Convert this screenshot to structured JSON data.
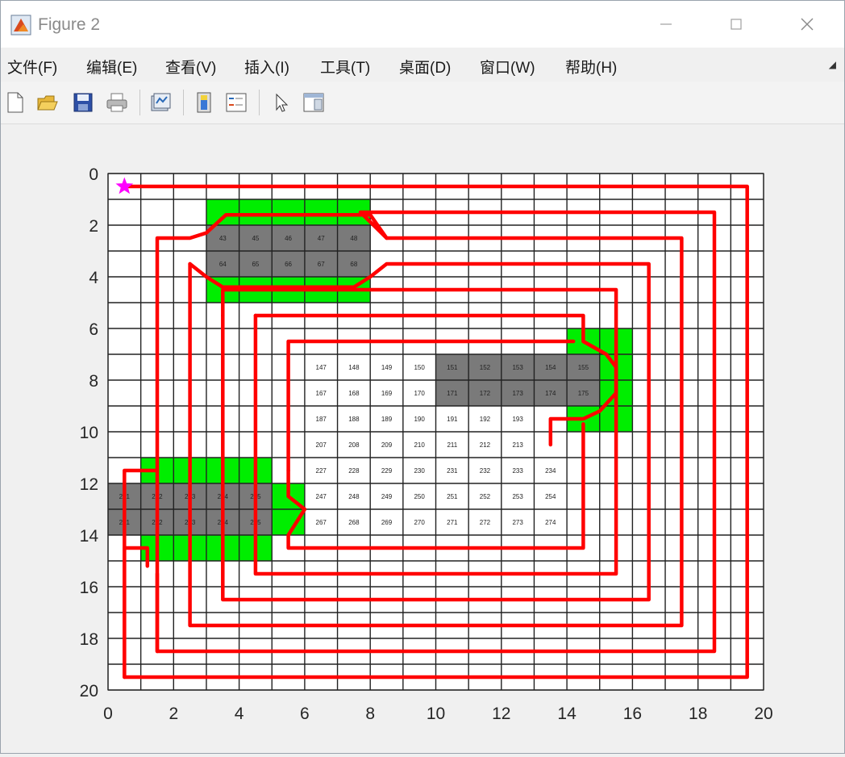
{
  "window": {
    "title": "Figure 2",
    "min_icon": "minimize-icon",
    "max_icon": "maximize-icon",
    "close_icon": "close-icon"
  },
  "menu": {
    "items": [
      "文件(F)",
      "编辑(E)",
      "查看(V)",
      "插入(I)",
      "工具(T)",
      "桌面(D)",
      "窗口(W)",
      "帮助(H)"
    ]
  },
  "toolbar": {
    "buttons": [
      "new-figure-icon",
      "open-file-icon",
      "save-icon",
      "print-icon",
      "link-plot-icon",
      "insert-colorbar-icon",
      "insert-legend-icon",
      "edit-plot-icon",
      "property-inspector-icon"
    ]
  },
  "plot": {
    "x_ticks": [
      "0",
      "2",
      "4",
      "6",
      "8",
      "10",
      "12",
      "14",
      "16",
      "18",
      "20"
    ],
    "y_ticks": [
      "0",
      "2",
      "4",
      "6",
      "8",
      "10",
      "12",
      "14",
      "16",
      "18",
      "20"
    ],
    "colors": {
      "path": "#ff0000",
      "obstacle": "#7a7a7a",
      "buffer": "#00ee00",
      "start": "#ff00ff",
      "grid": "#222222"
    }
  },
  "chart_data": {
    "type": "grid-path",
    "xlim": [
      0,
      20
    ],
    "ylim": [
      0,
      20
    ],
    "y_direction": "reversed",
    "grid": true,
    "start_marker": {
      "x": 0.5,
      "y": 0.5,
      "shape": "star"
    },
    "obstacles": [
      {
        "x_range": [
          3,
          8
        ],
        "y_range": [
          2,
          4
        ]
      },
      {
        "x_range": [
          10,
          15
        ],
        "y_range": [
          7,
          9
        ]
      },
      {
        "x_range": [
          0,
          5
        ],
        "y_range": [
          12,
          14
        ]
      }
    ],
    "buffer_zones": [
      {
        "x_range": [
          3,
          8
        ],
        "y_range": [
          1,
          5
        ]
      },
      {
        "x_range": [
          14,
          16
        ],
        "y_range": [
          6,
          10
        ]
      },
      {
        "x_range": [
          1,
          5
        ],
        "y_range": [
          11,
          15
        ]
      },
      {
        "x_range": [
          5,
          6
        ],
        "y_range": [
          12,
          14
        ]
      }
    ],
    "cell_labels": [
      {
        "n": 43,
        "x": 3.5,
        "y": 2.5
      },
      {
        "n": 45,
        "x": 4.5,
        "y": 2.5
      },
      {
        "n": 46,
        "x": 5.5,
        "y": 2.5
      },
      {
        "n": 47,
        "x": 6.5,
        "y": 2.5
      },
      {
        "n": 48,
        "x": 7.5,
        "y": 2.5
      },
      {
        "n": 64,
        "x": 3.5,
        "y": 3.5
      },
      {
        "n": 65,
        "x": 4.5,
        "y": 3.5
      },
      {
        "n": 66,
        "x": 5.5,
        "y": 3.5
      },
      {
        "n": 67,
        "x": 6.5,
        "y": 3.5
      },
      {
        "n": 68,
        "x": 7.5,
        "y": 3.5
      },
      {
        "n": 147,
        "x": 6.5,
        "y": 7.5
      },
      {
        "n": 148,
        "x": 7.5,
        "y": 7.5
      },
      {
        "n": 149,
        "x": 8.5,
        "y": 7.5
      },
      {
        "n": 150,
        "x": 9.5,
        "y": 7.5
      },
      {
        "n": 151,
        "x": 10.5,
        "y": 7.5
      },
      {
        "n": 152,
        "x": 11.5,
        "y": 7.5
      },
      {
        "n": 153,
        "x": 12.5,
        "y": 7.5
      },
      {
        "n": 154,
        "x": 13.5,
        "y": 7.5
      },
      {
        "n": 155,
        "x": 14.5,
        "y": 7.5
      },
      {
        "n": 167,
        "x": 6.5,
        "y": 8.5
      },
      {
        "n": 168,
        "x": 7.5,
        "y": 8.5
      },
      {
        "n": 169,
        "x": 8.5,
        "y": 8.5
      },
      {
        "n": 170,
        "x": 9.5,
        "y": 8.5
      },
      {
        "n": 171,
        "x": 10.5,
        "y": 8.5
      },
      {
        "n": 172,
        "x": 11.5,
        "y": 8.5
      },
      {
        "n": 173,
        "x": 12.5,
        "y": 8.5
      },
      {
        "n": 174,
        "x": 13.5,
        "y": 8.5
      },
      {
        "n": 175,
        "x": 14.5,
        "y": 8.5
      },
      {
        "n": 187,
        "x": 6.5,
        "y": 9.5
      },
      {
        "n": 188,
        "x": 7.5,
        "y": 9.5
      },
      {
        "n": 189,
        "x": 8.5,
        "y": 9.5
      },
      {
        "n": 190,
        "x": 9.5,
        "y": 9.5
      },
      {
        "n": 191,
        "x": 10.5,
        "y": 9.5
      },
      {
        "n": 192,
        "x": 11.5,
        "y": 9.5
      },
      {
        "n": 193,
        "x": 12.5,
        "y": 9.5
      },
      {
        "n": 207,
        "x": 6.5,
        "y": 10.5
      },
      {
        "n": 208,
        "x": 7.5,
        "y": 10.5
      },
      {
        "n": 209,
        "x": 8.5,
        "y": 10.5
      },
      {
        "n": 210,
        "x": 9.5,
        "y": 10.5
      },
      {
        "n": 211,
        "x": 10.5,
        "y": 10.5
      },
      {
        "n": 212,
        "x": 11.5,
        "y": 10.5
      },
      {
        "n": 213,
        "x": 12.5,
        "y": 10.5
      },
      {
        "n": 227,
        "x": 6.5,
        "y": 11.5
      },
      {
        "n": 228,
        "x": 7.5,
        "y": 11.5
      },
      {
        "n": 229,
        "x": 8.5,
        "y": 11.5
      },
      {
        "n": 230,
        "x": 9.5,
        "y": 11.5
      },
      {
        "n": 231,
        "x": 10.5,
        "y": 11.5
      },
      {
        "n": 232,
        "x": 11.5,
        "y": 11.5
      },
      {
        "n": 233,
        "x": 12.5,
        "y": 11.5
      },
      {
        "n": 234,
        "x": 13.5,
        "y": 11.5
      },
      {
        "n": 241,
        "x": 0.5,
        "y": 12.5
      },
      {
        "n": 242,
        "x": 1.5,
        "y": 12.5
      },
      {
        "n": 243,
        "x": 2.5,
        "y": 12.5
      },
      {
        "n": 244,
        "x": 3.5,
        "y": 12.5
      },
      {
        "n": 245,
        "x": 4.5,
        "y": 12.5
      },
      {
        "n": 247,
        "x": 6.5,
        "y": 12.5
      },
      {
        "n": 248,
        "x": 7.5,
        "y": 12.5
      },
      {
        "n": 249,
        "x": 8.5,
        "y": 12.5
      },
      {
        "n": 250,
        "x": 9.5,
        "y": 12.5
      },
      {
        "n": 251,
        "x": 10.5,
        "y": 12.5
      },
      {
        "n": 252,
        "x": 11.5,
        "y": 12.5
      },
      {
        "n": 253,
        "x": 12.5,
        "y": 12.5
      },
      {
        "n": 254,
        "x": 13.5,
        "y": 12.5
      },
      {
        "n": 261,
        "x": 0.5,
        "y": 13.5
      },
      {
        "n": 262,
        "x": 1.5,
        "y": 13.5
      },
      {
        "n": 263,
        "x": 2.5,
        "y": 13.5
      },
      {
        "n": 264,
        "x": 3.5,
        "y": 13.5
      },
      {
        "n": 265,
        "x": 4.5,
        "y": 13.5
      },
      {
        "n": 267,
        "x": 6.5,
        "y": 13.5
      },
      {
        "n": 268,
        "x": 7.5,
        "y": 13.5
      },
      {
        "n": 269,
        "x": 8.5,
        "y": 13.5
      },
      {
        "n": 270,
        "x": 9.5,
        "y": 13.5
      },
      {
        "n": 271,
        "x": 10.5,
        "y": 13.5
      },
      {
        "n": 272,
        "x": 11.5,
        "y": 13.5
      },
      {
        "n": 273,
        "x": 12.5,
        "y": 13.5
      },
      {
        "n": 274,
        "x": 13.5,
        "y": 13.5
      }
    ],
    "path": [
      [
        0.5,
        0.5
      ],
      [
        19.5,
        0.5
      ],
      [
        19.5,
        19.5
      ],
      [
        0.5,
        19.5
      ],
      [
        0.5,
        11.5
      ],
      [
        1.5,
        11.5
      ],
      [
        1.5,
        18.5
      ],
      [
        18.5,
        18.5
      ],
      [
        18.5,
        1.5
      ],
      [
        8,
        1.5
      ],
      [
        7.5,
        1.5
      ],
      [
        3.5,
        1.5
      ],
      [
        3,
        2
      ],
      [
        2.5,
        2.5
      ],
      [
        1.5,
        2.5
      ],
      [
        1.5,
        11.5
      ],
      [
        2.5,
        11.5
      ],
      [
        2.5,
        17.5
      ],
      [
        17.5,
        17.5
      ],
      [
        17.5,
        2.5
      ],
      [
        8.5,
        2.5
      ],
      [
        8,
        2
      ],
      [
        7.5,
        1.5
      ],
      [
        3.5,
        1.5
      ],
      [
        3,
        2
      ],
      [
        2.5,
        2.5
      ],
      [
        1.5,
        2.5
      ],
      [
        16.5,
        3.5
      ],
      [
        8.5,
        3.5
      ],
      [
        8,
        4
      ],
      [
        7.5,
        4.5
      ],
      [
        3.5,
        4.5
      ],
      [
        3,
        4
      ],
      [
        2.5,
        3.5
      ],
      [
        2.5,
        11.5
      ],
      [
        3.5,
        11.5
      ],
      [
        3.5,
        16.5
      ],
      [
        16.5,
        16.5
      ],
      [
        16.5,
        3.5
      ],
      [
        15.5,
        4.5
      ],
      [
        4.5,
        4.5
      ],
      [
        3.5,
        4.5
      ],
      [
        3.5,
        11.5
      ]
    ],
    "path_rings": [
      {
        "pts": [
          [
            0.5,
            0.5
          ],
          [
            19.5,
            0.5
          ],
          [
            19.5,
            19.5
          ],
          [
            0.5,
            19.5
          ],
          [
            0.5,
            11.5
          ],
          [
            1.5,
            11.5
          ]
        ]
      },
      {
        "pts": [
          [
            1.5,
            11.5
          ],
          [
            1.5,
            18.5
          ],
          [
            18.5,
            18.5
          ],
          [
            18.5,
            1.5
          ],
          [
            8,
            1.5
          ],
          [
            7.7,
            1.5
          ],
          [
            8.5,
            2.5
          ],
          [
            8,
            1.6
          ],
          [
            3.6,
            1.6
          ],
          [
            3,
            2.3
          ],
          [
            2.5,
            2.5
          ],
          [
            1.5,
            2.5
          ],
          [
            1.5,
            11.5
          ]
        ]
      },
      {
        "pts": [
          [
            2.5,
            11.5
          ],
          [
            2.5,
            17.5
          ],
          [
            17.5,
            17.5
          ],
          [
            17.5,
            2.5
          ],
          [
            8.5,
            2.5
          ]
        ]
      },
      {
        "pts": [
          [
            2.5,
            3.5
          ],
          [
            2.5,
            11.5
          ]
        ]
      },
      {
        "pts": [
          [
            3.5,
            11.5
          ],
          [
            3.5,
            16.5
          ],
          [
            16.5,
            16.5
          ],
          [
            16.5,
            3.5
          ],
          [
            8.5,
            3.5
          ],
          [
            8,
            4
          ],
          [
            7.5,
            4.4
          ],
          [
            3.5,
            4.4
          ],
          [
            3,
            4
          ],
          [
            2.5,
            3.5
          ]
        ]
      },
      {
        "pts": [
          [
            3.5,
            5.5
          ],
          [
            3.5,
            11.5
          ]
        ]
      },
      {
        "pts": [
          [
            4.5,
            11.5
          ],
          [
            4.5,
            15.5
          ],
          [
            15.5,
            15.5
          ],
          [
            15.5,
            4.5
          ],
          [
            3.5,
            4.5
          ],
          [
            3.5,
            5.5
          ]
        ]
      },
      {
        "pts": [
          [
            4.5,
            5.5
          ],
          [
            4.5,
            11.5
          ]
        ]
      },
      {
        "pts": [
          [
            4.5,
            5.5
          ],
          [
            14.5,
            5.5
          ],
          [
            14.5,
            6.5
          ],
          [
            15.2,
            7
          ],
          [
            15.5,
            7.5
          ],
          [
            15.5,
            8.5
          ],
          [
            15,
            9.2
          ],
          [
            14.5,
            9.5
          ],
          [
            13.5,
            9.5
          ],
          [
            13.5,
            10.5
          ]
        ]
      },
      {
        "pts": [
          [
            5.5,
            11.5
          ],
          [
            5.5,
            12.5
          ],
          [
            6,
            13
          ],
          [
            5.5,
            14
          ],
          [
            5.5,
            14.5
          ],
          [
            14.5,
            14.5
          ],
          [
            14.5,
            9.7
          ]
        ]
      },
      {
        "pts": [
          [
            5.5,
            11.5
          ],
          [
            5.5,
            6.5
          ],
          [
            14.2,
            6.5
          ]
        ]
      },
      {
        "pts": [
          [
            0.5,
            19.5
          ],
          [
            0.5,
            14.5
          ],
          [
            1.2,
            14.5
          ],
          [
            1.2,
            15.2
          ]
        ]
      },
      {
        "pts": [
          [
            1.5,
            18.5
          ],
          [
            1.5,
            15.5
          ]
        ]
      }
    ]
  }
}
